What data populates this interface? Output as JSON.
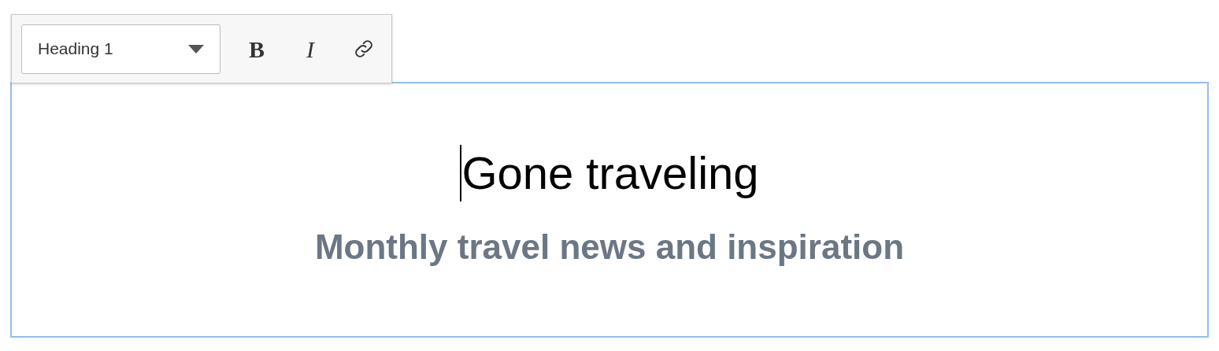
{
  "toolbar": {
    "block_format": {
      "value": "Heading 1"
    },
    "buttons": [
      {
        "kind": "bold",
        "label": "B"
      },
      {
        "kind": "italic",
        "label": "I"
      },
      {
        "kind": "link"
      }
    ]
  },
  "editor": {
    "focused": true,
    "heading": "Gone traveling",
    "subheading": "Monthly travel news and inspiration"
  }
}
